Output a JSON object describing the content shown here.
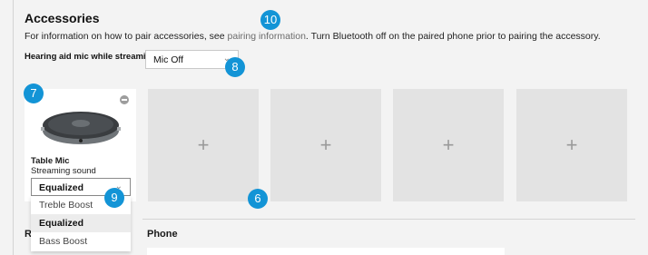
{
  "section": {
    "title": "Accessories",
    "info_before": "For information on how to pair accessories, see ",
    "info_link": "pairing information",
    "info_after": ". Turn Bluetooth off on the paired phone prior to pairing the accessory."
  },
  "mic_setting": {
    "label": "Hearing aid mic while streaming",
    "value": "Mic Off"
  },
  "accessory_card": {
    "name": "Table Mic",
    "subtitle": "Streaming sound",
    "selected_sound": "Equalized"
  },
  "sound_options": [
    "Treble Boost",
    "Equalized",
    "Bass Boost"
  ],
  "empty_slots": [
    "+",
    "+",
    "+",
    "+"
  ],
  "badges": {
    "b6": "6",
    "b7": "7",
    "b8": "8",
    "b9": "9",
    "b10": "10"
  },
  "lower_sections": {
    "left_heading_fragment": "R",
    "phone_heading": "Phone"
  },
  "icons": {
    "remove": "remove-circle-icon",
    "chevron": "chevron-down-icon",
    "add": "plus-icon",
    "device": "table-mic-device-icon"
  },
  "colors": {
    "badge": "#1394d6",
    "slot": "#e3e3e3",
    "background": "#f3f3f3"
  }
}
